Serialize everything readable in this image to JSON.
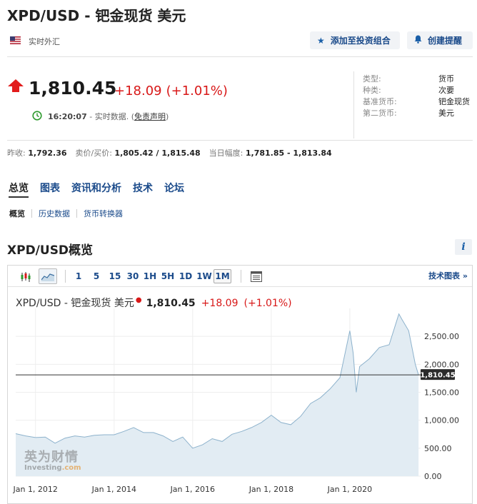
{
  "header": {
    "title": "XPD/USD - 钯金现货 美元",
    "market_label": "实时外汇",
    "portfolio_button": "添加至投资组合",
    "alert_button": "创建提醒"
  },
  "quote": {
    "price": "1,810.45",
    "change": "+18.09",
    "change_pct": "(+1.01%)",
    "time": "16:20:07",
    "realtime_text": "- 实时数据. (",
    "disclaimer": "免责声明",
    "close_paren": ")"
  },
  "info": [
    {
      "key": "类型:",
      "value": "货币"
    },
    {
      "key": "种类:",
      "value": "次要"
    },
    {
      "key": "基准货币:",
      "value": "钯金现货"
    },
    {
      "key": "第二货币:",
      "value": "美元"
    }
  ],
  "stats": {
    "prev_close_label": "昨收:",
    "prev_close": "1,792.36",
    "bid_ask_label": "卖价/买价:",
    "bid_ask": "1,805.42 / 1,815.48",
    "day_range_label": "当日幅度:",
    "day_range": "1,781.85 - 1,813.84"
  },
  "tabs": [
    "总览",
    "图表",
    "资讯和分析",
    "技术",
    "论坛"
  ],
  "sub_tabs": [
    "概览",
    "历史数据",
    "货币转换器"
  ],
  "section_title": "XPD/USD概览",
  "toolbar": {
    "timeframes": [
      "1",
      "5",
      "15",
      "30",
      "1H",
      "5H",
      "1D",
      "1W",
      "1M"
    ],
    "active_timeframe": "1M",
    "tech_chart_link": "技术图表 »"
  },
  "chart_header": {
    "title": "XPD/USD - 钯金现货 美元",
    "price": "1,810.45",
    "change": "+18.09",
    "change_pct": "(+1.01%)"
  },
  "watermark": {
    "cn": "英为财情",
    "en": "Investing",
    "suffix": ".com"
  },
  "colors": {
    "up": "#d81818",
    "link": "#1a4a8a",
    "area_fill": "#e2ecf3",
    "area_line": "#8db2cc"
  },
  "chart_data": {
    "type": "area",
    "x": [
      "2011-07",
      "2011-10",
      "2012-01",
      "2012-04",
      "2012-07",
      "2012-10",
      "2013-01",
      "2013-04",
      "2013-07",
      "2013-10",
      "2014-01",
      "2014-04",
      "2014-07",
      "2014-10",
      "2015-01",
      "2015-04",
      "2015-07",
      "2015-10",
      "2016-01",
      "2016-04",
      "2016-07",
      "2016-10",
      "2017-01",
      "2017-04",
      "2017-07",
      "2017-10",
      "2018-01",
      "2018-04",
      "2018-07",
      "2018-10",
      "2019-01",
      "2019-04",
      "2019-07",
      "2019-10",
      "2020-01",
      "2020-02",
      "2020-03",
      "2020-04",
      "2020-07",
      "2020-10",
      "2021-01",
      "2021-04",
      "2021-05",
      "2021-07",
      "2021-09",
      "2021-10"
    ],
    "series": [
      {
        "values": [
          760,
          720,
          690,
          700,
          590,
          680,
          720,
          700,
          730,
          740,
          740,
          800,
          870,
          780,
          780,
          720,
          620,
          700,
          500,
          560,
          670,
          620,
          750,
          800,
          870,
          960,
          1090,
          960,
          920,
          1070,
          1300,
          1400,
          1560,
          1760,
          2600,
          2200,
          1500,
          1960,
          2100,
          2300,
          2350,
          2900,
          2800,
          2600,
          2000,
          1810
        ]
      }
    ],
    "xticks": [
      "Jan 1, 2012",
      "Jan 1, 2014",
      "Jan 1, 2016",
      "Jan 1, 2018",
      "Jan 1, 2020"
    ],
    "yticks": [
      "0.00",
      "500.00",
      "1,000.00",
      "1,500.00",
      "2,000.00",
      "2,500.00"
    ],
    "ylim": [
      0,
      3000
    ],
    "current_value_label": "1,810.45",
    "current_value": 1810.45,
    "grid": true
  }
}
